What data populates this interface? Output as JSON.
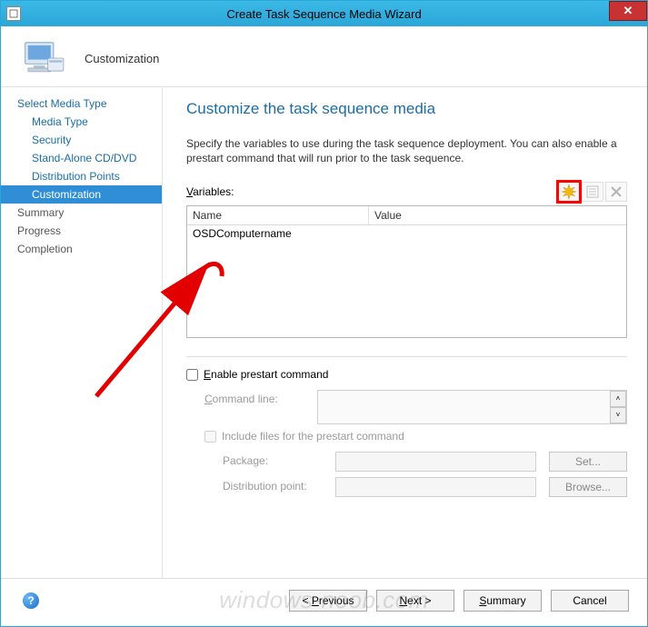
{
  "window": {
    "title": "Create Task Sequence Media Wizard"
  },
  "header": {
    "step_label": "Customization"
  },
  "sidebar": {
    "items": [
      {
        "label": "Select Media Type",
        "sub": false,
        "selected": false,
        "inactive": false
      },
      {
        "label": "Media Type",
        "sub": true,
        "selected": false,
        "inactive": false
      },
      {
        "label": "Security",
        "sub": true,
        "selected": false,
        "inactive": false
      },
      {
        "label": "Stand-Alone CD/DVD",
        "sub": true,
        "selected": false,
        "inactive": false
      },
      {
        "label": "Distribution Points",
        "sub": true,
        "selected": false,
        "inactive": false
      },
      {
        "label": "Customization",
        "sub": true,
        "selected": true,
        "inactive": false
      },
      {
        "label": "Summary",
        "sub": false,
        "selected": false,
        "inactive": true
      },
      {
        "label": "Progress",
        "sub": false,
        "selected": false,
        "inactive": true
      },
      {
        "label": "Completion",
        "sub": false,
        "selected": false,
        "inactive": true
      }
    ]
  },
  "page": {
    "heading": "Customize the task sequence media",
    "instruction": "Specify the variables to use during the task sequence deployment. You can also enable a prestart command that will run prior to the task sequence.",
    "variables_label_pre": "V",
    "variables_label_post": "ariables:",
    "columns": {
      "name": "Name",
      "value": "Value"
    },
    "rows": [
      {
        "name": "OSDComputername",
        "value": ""
      }
    ],
    "enable_prestart_label_pre": "E",
    "enable_prestart_label_post": "nable prestart command",
    "command_line_label_pre": "C",
    "command_line_label_post": "ommand line:",
    "include_files_label": "Include files for the prestart command",
    "package_label": "Package:",
    "dist_point_label": "Distribution point:",
    "set_btn": "Set...",
    "browse_btn": "Browse..."
  },
  "footer": {
    "previous_pre": "< ",
    "previous_accel": "P",
    "previous_post": "revious",
    "next_pre": "",
    "next_accel": "N",
    "next_post": "ext >",
    "summary_pre": "",
    "summary_accel": "S",
    "summary_post": "ummary",
    "cancel": "Cancel"
  },
  "watermark": "windows-noob.com"
}
